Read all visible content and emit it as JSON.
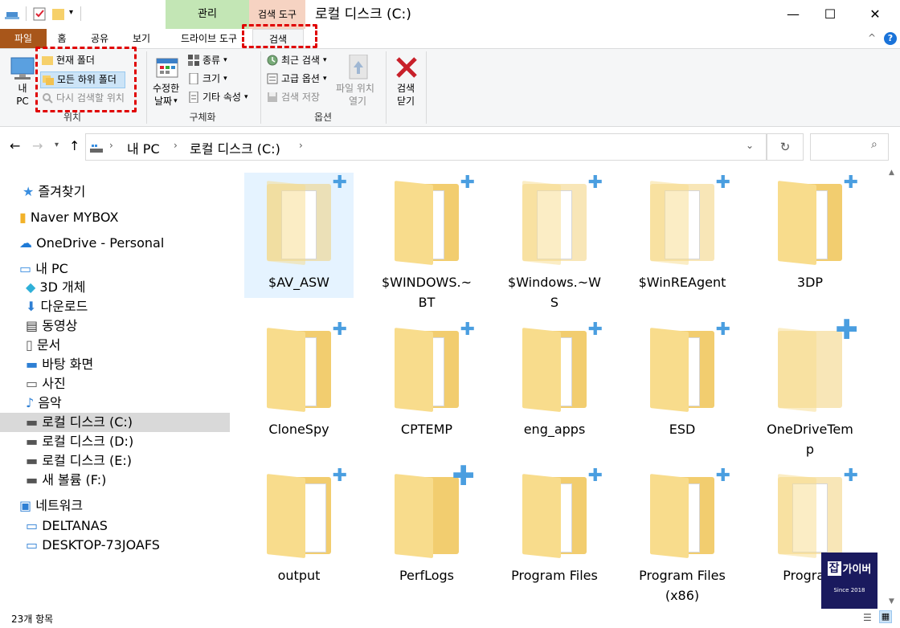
{
  "window": {
    "title": "로컬 디스크 (C:)",
    "minimize": "—",
    "maximize": "☐",
    "close": "✕"
  },
  "context_tabs": {
    "manage": "관리",
    "search_tools": "검색 도구"
  },
  "tabs": {
    "file": "파일",
    "home": "홈",
    "share": "공유",
    "view": "보기",
    "drive_tools": "드라이브 도구",
    "search": "검색"
  },
  "ribbon": {
    "location": {
      "name": "위치",
      "this_pc": [
        "내",
        "PC"
      ],
      "current_folder": "현재 폴더",
      "all_subfolders": "모든 하위 폴더",
      "search_again_in": "다시 검색할 위치"
    },
    "refine": {
      "name": "구체화",
      "date_modified": [
        "수정한",
        "날짜"
      ],
      "kind": "종류",
      "size": "크기",
      "other_properties": "기타 속성"
    },
    "options": {
      "name": "옵션",
      "recent_searches": "최근 검색",
      "advanced_options": "고급 옵션",
      "save_search": "검색 저장",
      "open_file_location": [
        "파일 위치",
        "열기"
      ]
    },
    "close_search": [
      "검색",
      "닫기"
    ]
  },
  "address": {
    "this_pc": "내 PC",
    "drive": "로컬 디스크 (C:)"
  },
  "nav": [
    {
      "label": "즐겨찾기",
      "icon": "star-icon"
    },
    {
      "label": "Naver MYBOX",
      "icon": "cloud-folder-icon"
    },
    {
      "label": "OneDrive - Personal",
      "icon": "onedrive-icon"
    },
    {
      "label": "내 PC",
      "icon": "computer-icon"
    },
    {
      "label": "3D 개체",
      "icon": "cube-icon"
    },
    {
      "label": "다운로드",
      "icon": "download-icon"
    },
    {
      "label": "동영상",
      "icon": "film-icon"
    },
    {
      "label": "문서",
      "icon": "document-icon"
    },
    {
      "label": "바탕 화면",
      "icon": "desktop-icon"
    },
    {
      "label": "사진",
      "icon": "pictures-icon"
    },
    {
      "label": "음악",
      "icon": "music-icon"
    },
    {
      "label": "로컬 디스크 (C:)",
      "icon": "drive-icon"
    },
    {
      "label": "로컬 디스크 (D:)",
      "icon": "drive-icon"
    },
    {
      "label": "로컬 디스크 (E:)",
      "icon": "drive-icon"
    },
    {
      "label": "새 볼륨 (F:)",
      "icon": "drive-icon"
    },
    {
      "label": "네트워크",
      "icon": "network-icon"
    },
    {
      "label": "DELTANAS",
      "icon": "monitor-icon"
    },
    {
      "label": "DESKTOP-73JOAFS",
      "icon": "monitor-icon"
    }
  ],
  "files": [
    [
      "$AV_ASW"
    ],
    [
      "$WINDOWS.~",
      "BT"
    ],
    [
      "$Windows.~W",
      "S"
    ],
    [
      "$WinREAgent"
    ],
    [
      "3DP"
    ],
    [
      "CloneSpy"
    ],
    [
      "CPTEMP"
    ],
    [
      "eng_apps"
    ],
    [
      "ESD"
    ],
    [
      "OneDriveTem",
      "p"
    ],
    [
      "output"
    ],
    [
      "PerfLogs"
    ],
    [
      "Program Files"
    ],
    [
      "Program Files",
      "(x86)"
    ],
    [
      "Program"
    ]
  ],
  "status": {
    "count": "23개 항목"
  },
  "watermark": {
    "line1": "잡",
    "line2": "가이버",
    "since": "Since 2018"
  }
}
